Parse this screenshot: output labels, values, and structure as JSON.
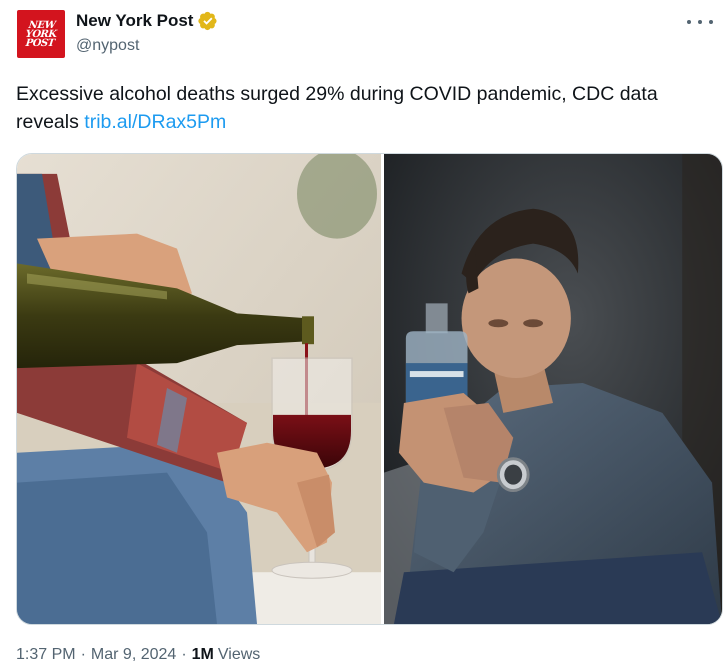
{
  "author": {
    "avatar_lines": [
      "NEW",
      "YORK",
      "POST"
    ],
    "display_name": "New York Post",
    "handle": "@nypost",
    "verified_color": "#e2b719"
  },
  "post": {
    "text": "Excessive alcohol deaths surged 29% during COVID pandemic, CDC data reveals",
    "text_line1": "Excessive alcohol deaths surged 29% during COVID pandemic, CDC data",
    "text_line2": "reveals",
    "link": "trib.al/DRax5Pm"
  },
  "media": {
    "images": [
      "wine-pouring-photo",
      "man-with-bottle-photo"
    ]
  },
  "meta": {
    "time": "1:37 PM",
    "separator": "·",
    "date": "Mar 9, 2024",
    "views_count": "1M",
    "views_label": "Views"
  },
  "colors": {
    "brand_red": "#d3141e",
    "link_blue": "#1d9bf0",
    "secondary_text": "#536471"
  },
  "icons": [
    "verified-badge-icon",
    "more-options-icon"
  ]
}
